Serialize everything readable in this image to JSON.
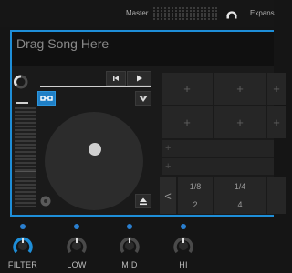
{
  "topbar": {
    "master_label": "Master",
    "expand_label": "Expans"
  },
  "deck": {
    "song_placeholder": "Drag Song Here"
  },
  "pads": {
    "grid": [
      "+",
      "+",
      "+",
      "+",
      "+",
      "+"
    ],
    "rows": [
      "+",
      "+"
    ],
    "beat_values": [
      {
        "top": "1/8",
        "bottom": "2"
      },
      {
        "top": "1/4",
        "bottom": "4"
      },
      {
        "top": "",
        "bottom": ""
      }
    ],
    "beat_prev": "<"
  },
  "knobs": [
    {
      "label": "FILTER",
      "active": true
    },
    {
      "label": "LOW",
      "active": false
    },
    {
      "label": "MID",
      "active": false
    },
    {
      "label": "HI",
      "active": false
    }
  ],
  "colors": {
    "accent": "#1e8ed8",
    "background": "#151515"
  }
}
